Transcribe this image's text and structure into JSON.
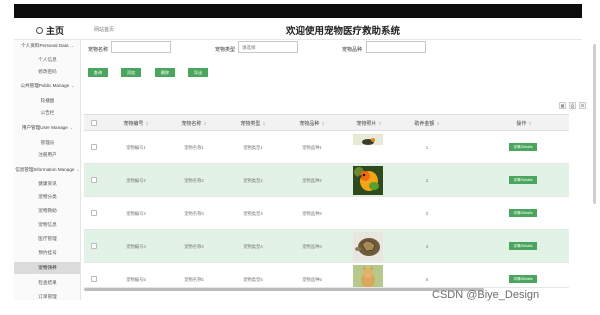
{
  "header": {
    "home_label": "主页",
    "breadcrumb": "网站首页",
    "title": "欢迎使用宠物医疗救助系统"
  },
  "sidebar": {
    "groups": [
      {
        "label": "个人资料Personal Data",
        "items": [
          "个人信息",
          "修改密码"
        ]
      },
      {
        "label": "公共管理Public Manage",
        "items": [
          "轮播图",
          "公告栏"
        ]
      },
      {
        "label": "用户管理User Manage",
        "items": [
          "管理员",
          "注册用户"
        ]
      },
      {
        "label": "信息管理Information Manage",
        "items": [
          "健康资讯",
          "宠物分类",
          "宠物救助",
          "宠物信息",
          "医疗管理",
          "预约挂号",
          "宠物领养",
          "检查结果",
          "订单管理"
        ]
      }
    ],
    "active_item": "宠物领养"
  },
  "search": {
    "fields": [
      {
        "label": "宠物名称",
        "placeholder": ""
      },
      {
        "label": "宠物类型",
        "placeholder": "请选择"
      },
      {
        "label": "宠物品种",
        "placeholder": ""
      }
    ]
  },
  "actions": {
    "query": "查询",
    "add": "添加",
    "delete": "删除",
    "export": "导出"
  },
  "table": {
    "columns": [
      "宠物编号",
      "宠物名称",
      "宠物类型",
      "宠物品种",
      "宠物照片",
      "助养金额",
      "操作"
    ],
    "rows": [
      {
        "id": "宠物编号1",
        "name": "宠物名称1",
        "type": "宠物类型1",
        "breed": "宠物品种1",
        "photo": "bird-photo",
        "amount": "1",
        "action": "详情/Details"
      },
      {
        "id": "宠物编号2",
        "name": "宠物名称2",
        "type": "宠物类型2",
        "breed": "宠物品种2",
        "photo": "parrot-photo",
        "amount": "2",
        "action": "详情/Details"
      },
      {
        "id": "宠物编号3",
        "name": "宠物名称3",
        "type": "宠物类型3",
        "breed": "宠物品种3",
        "photo": "",
        "amount": "3",
        "action": "详情/Details"
      },
      {
        "id": "宠物编号4",
        "name": "宠物名称4",
        "type": "宠物类型4",
        "breed": "宠物品种4",
        "photo": "tortoise-photo",
        "amount": "4",
        "action": "详情/Details"
      },
      {
        "id": "宠物编号5",
        "name": "宠物名称5",
        "type": "宠物类型5",
        "breed": "宠物品种5",
        "photo": "cat-photo",
        "amount": "5",
        "action": "详情/Details"
      }
    ]
  },
  "watermark": "CSDN @Biye_Design",
  "colors": {
    "accent": "#4aa55f",
    "row_alt": "#e3f2e6"
  }
}
